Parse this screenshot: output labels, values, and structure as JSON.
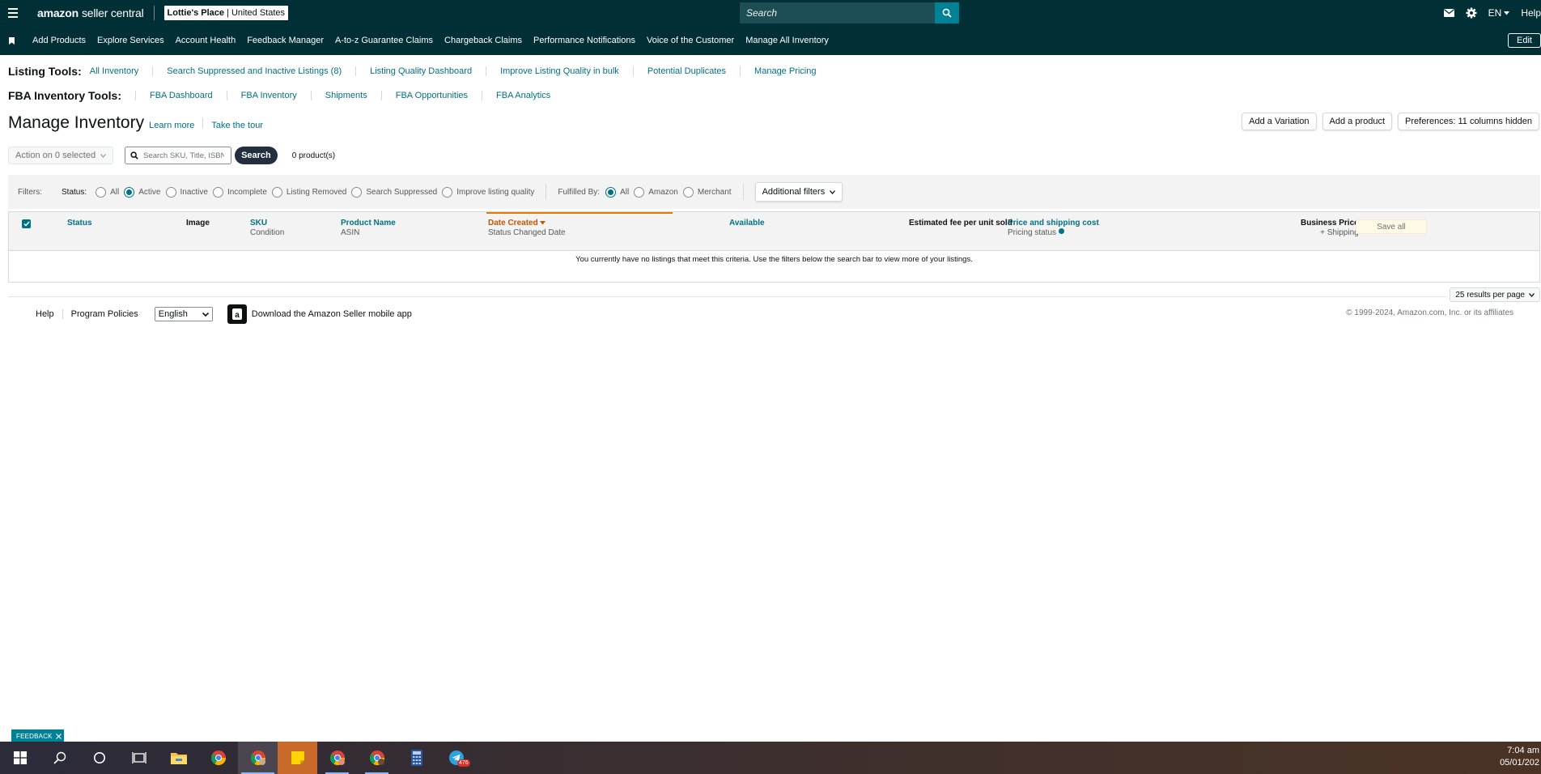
{
  "header": {
    "brand_bold": "amazon",
    "brand_rest": "seller central",
    "store_name": "Lottie's Place",
    "store_sep": " | ",
    "store_country": "United States",
    "search_placeholder": "Search",
    "lang": "EN",
    "help": "Help"
  },
  "nav": {
    "items": [
      "Add Products",
      "Explore Services",
      "Account Health",
      "Feedback Manager",
      "A-to-z Guarantee Claims",
      "Chargeback Claims",
      "Performance Notifications",
      "Voice of the Customer",
      "Manage All Inventory"
    ],
    "edit": "Edit"
  },
  "listing_tools": {
    "label": "Listing Tools:",
    "links": [
      "All Inventory",
      "Search Suppressed and Inactive Listings (8)",
      "Listing Quality Dashboard",
      "Improve Listing Quality in bulk",
      "Potential Duplicates",
      "Manage Pricing"
    ]
  },
  "fba_tools": {
    "label": "FBA Inventory Tools:",
    "links": [
      "FBA Dashboard",
      "FBA Inventory",
      "Shipments",
      "FBA Opportunities",
      "FBA Analytics"
    ]
  },
  "page": {
    "title": "Manage Inventory",
    "learn_more": "Learn more",
    "tour": "Take the tour",
    "add_variation": "Add a Variation",
    "add_product": "Add a product",
    "preferences": "Preferences: 11 columns hidden"
  },
  "actions": {
    "action_dd": "Action on 0 selected",
    "search_placeholder": "Search SKU, Title, ISBN",
    "search_btn": "Search",
    "count": "0 product(s)"
  },
  "filters": {
    "label": "Filters:",
    "status_label": "Status:",
    "status_options": [
      "All",
      "Active",
      "Inactive",
      "Incomplete",
      "Listing Removed",
      "Search Suppressed",
      "Improve listing quality"
    ],
    "status_selected": "Active",
    "fulfilled_label": "Fulfilled By:",
    "fulfilled_options": [
      "All",
      "Amazon",
      "Merchant"
    ],
    "fulfilled_selected": "All",
    "additional": "Additional filters"
  },
  "table": {
    "columns": {
      "status": "Status",
      "image": "Image",
      "sku": "SKU",
      "condition": "Condition",
      "product_name": "Product Name",
      "asin": "ASIN",
      "date_created": "Date Created",
      "status_changed": "Status Changed Date",
      "available": "Available",
      "est_fee": "Estimated fee per unit sold",
      "price_shipping": "Price and shipping cost",
      "pricing_status": "Pricing status",
      "business_price": "Business Price",
      "plus_shipping": "+ Shipping"
    },
    "save_all": "Save all",
    "empty_message": "You currently have no listings that meet this criteria. Use the filters below the search bar to view more of your listings."
  },
  "results_per_page": "25 results per page",
  "footer": {
    "help": "Help",
    "policies": "Program Policies",
    "language": "English",
    "app": "Download the Amazon Seller mobile app",
    "copyright": "© 1999-2024, Amazon.com, Inc. or its affiliates"
  },
  "feedback": "FEEDBACK",
  "taskbar": {
    "time": "7:04 am",
    "date": "05/01/202",
    "telegram_badge": "476"
  },
  "colors": {
    "header_bg": "#002f36",
    "link": "#007185",
    "sorted": "#c45500",
    "accent_teal": "#008296"
  }
}
